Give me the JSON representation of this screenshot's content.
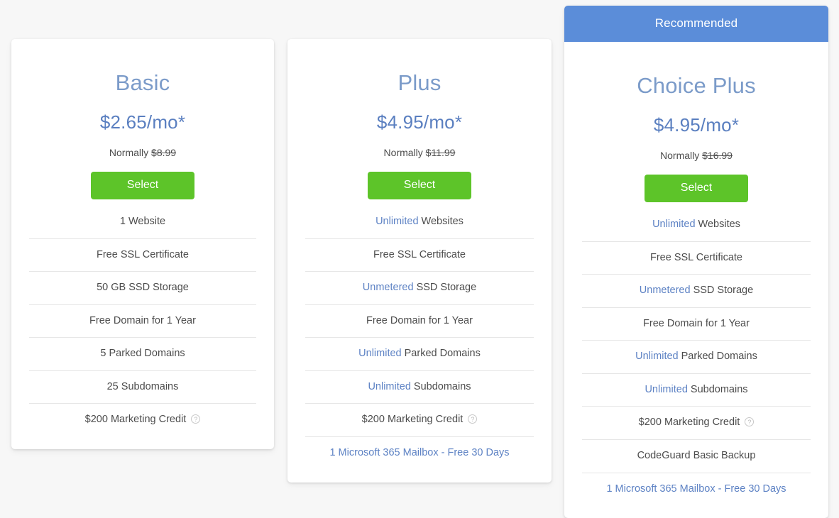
{
  "page": {
    "background_color": "#f7f7f7",
    "accent_blue": "#5b8dd9",
    "title_blue": "#7b9bc9",
    "price_blue": "#5a7fc0",
    "link_blue": "#5d82c4",
    "select_green": "#5dc429",
    "text_gray": "#4c4c4c",
    "divider_gray": "#e6e6e6"
  },
  "plans": [
    {
      "id": "basic",
      "name": "Basic",
      "price": "$2.65/mo*",
      "normally_label": "Normally",
      "normally_price": "$8.99",
      "select_label": "Select",
      "recommended": false,
      "features": [
        {
          "highlight": "",
          "text": "1 Website",
          "link": false,
          "info": false
        },
        {
          "highlight": "",
          "text": "Free SSL Certificate",
          "link": false,
          "info": false
        },
        {
          "highlight": "",
          "text": "50 GB SSD Storage",
          "link": false,
          "info": false
        },
        {
          "highlight": "",
          "text": "Free Domain for 1 Year",
          "link": false,
          "info": false
        },
        {
          "highlight": "",
          "text": "5 Parked Domains",
          "link": false,
          "info": false
        },
        {
          "highlight": "",
          "text": "25 Subdomains",
          "link": false,
          "info": false
        },
        {
          "highlight": "",
          "text": "$200 Marketing Credit",
          "link": false,
          "info": true
        }
      ]
    },
    {
      "id": "plus",
      "name": "Plus",
      "price": "$4.95/mo*",
      "normally_label": "Normally",
      "normally_price": "$11.99",
      "select_label": "Select",
      "recommended": false,
      "features": [
        {
          "highlight": "Unlimited",
          "text": "Websites",
          "link": false,
          "info": false
        },
        {
          "highlight": "",
          "text": "Free SSL Certificate",
          "link": false,
          "info": false
        },
        {
          "highlight": "Unmetered",
          "text": "SSD Storage",
          "link": false,
          "info": false
        },
        {
          "highlight": "",
          "text": "Free Domain for 1 Year",
          "link": false,
          "info": false
        },
        {
          "highlight": "Unlimited",
          "text": "Parked Domains",
          "link": false,
          "info": false
        },
        {
          "highlight": "Unlimited",
          "text": "Subdomains",
          "link": false,
          "info": false
        },
        {
          "highlight": "",
          "text": "$200 Marketing Credit",
          "link": false,
          "info": true
        },
        {
          "highlight": "",
          "text": "1 Microsoft 365 Mailbox - Free 30 Days",
          "link": true,
          "info": false
        }
      ]
    },
    {
      "id": "choiceplus",
      "name": "Choice Plus",
      "price": "$4.95/mo*",
      "normally_label": "Normally",
      "normally_price": "$16.99",
      "select_label": "Select",
      "recommended": true,
      "recommended_label": "Recommended",
      "features": [
        {
          "highlight": "Unlimited",
          "text": "Websites",
          "link": false,
          "info": false
        },
        {
          "highlight": "",
          "text": "Free SSL Certificate",
          "link": false,
          "info": false
        },
        {
          "highlight": "Unmetered",
          "text": "SSD Storage",
          "link": false,
          "info": false
        },
        {
          "highlight": "",
          "text": "Free Domain for 1 Year",
          "link": false,
          "info": false
        },
        {
          "highlight": "Unlimited",
          "text": "Parked Domains",
          "link": false,
          "info": false
        },
        {
          "highlight": "Unlimited",
          "text": "Subdomains",
          "link": false,
          "info": false
        },
        {
          "highlight": "",
          "text": "$200 Marketing Credit",
          "link": false,
          "info": true
        },
        {
          "highlight": "",
          "text": "CodeGuard Basic Backup",
          "link": false,
          "info": false
        },
        {
          "highlight": "",
          "text": "1 Microsoft 365 Mailbox - Free 30 Days",
          "link": true,
          "info": false
        }
      ]
    }
  ],
  "icons": {
    "info": "?",
    "info_name": "info-tooltip-icon"
  }
}
